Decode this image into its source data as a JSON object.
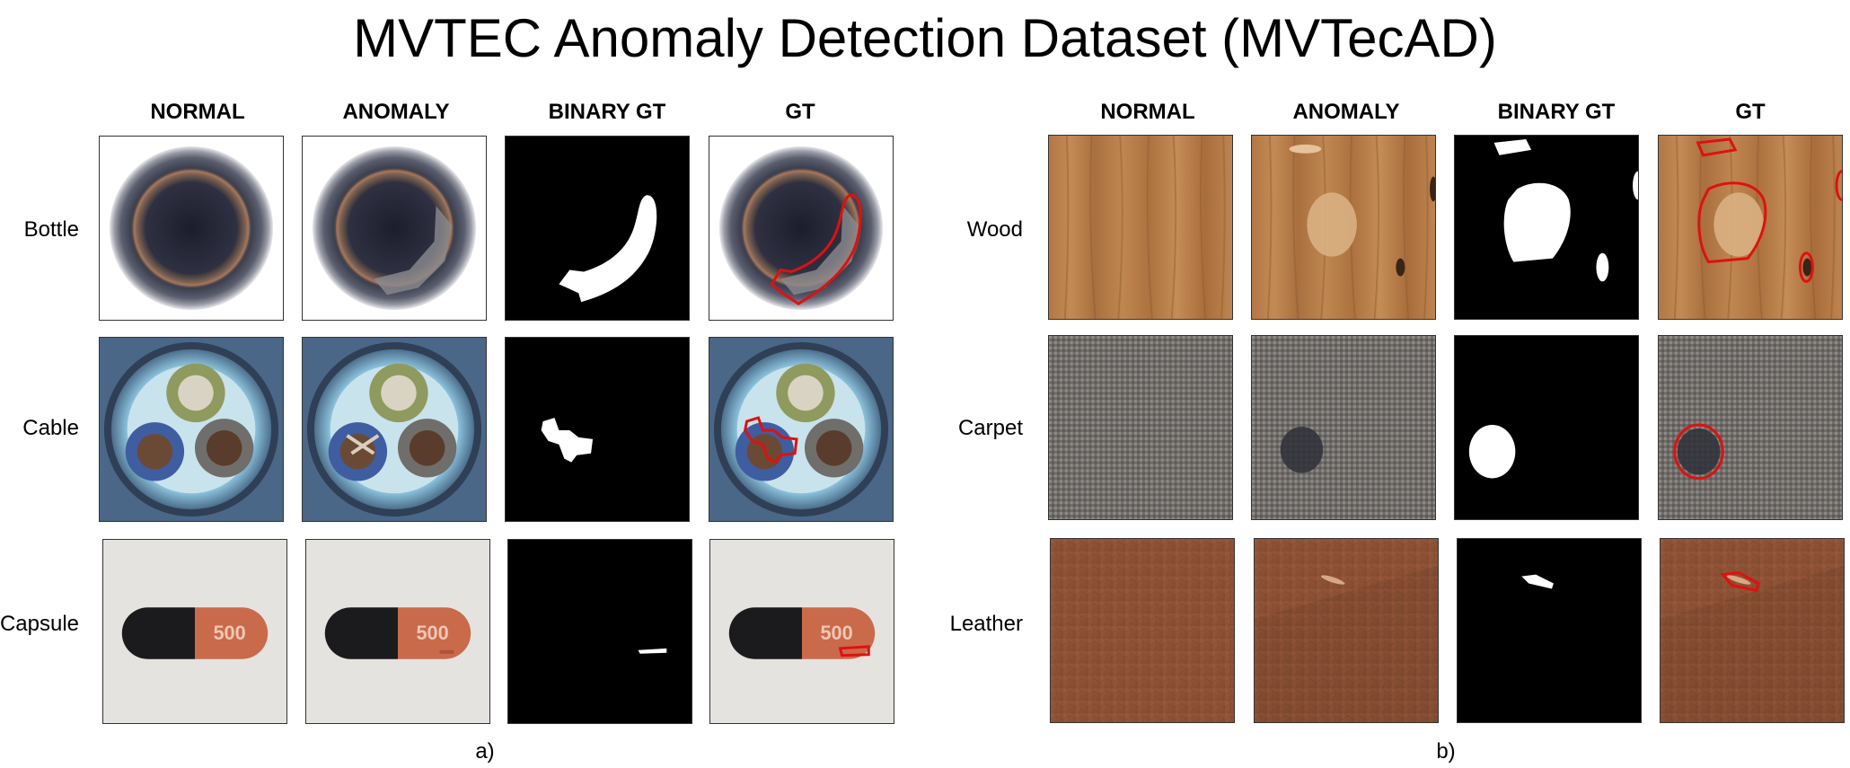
{
  "title": "MVTEC Anomaly Detection Dataset (MVTecAD)",
  "panel_a": {
    "columns": [
      "NORMAL",
      "ANOMALY",
      "BINARY GT",
      "GT"
    ],
    "rows": [
      "Bottle",
      "Cable",
      "Capsule"
    ],
    "caption": "a)"
  },
  "panel_b": {
    "columns": [
      "NORMAL",
      "ANOMALY",
      "BINARY GT",
      "GT"
    ],
    "rows": [
      "Wood",
      "Carpet",
      "Leather"
    ],
    "caption": "b)"
  },
  "capsule_print": "500",
  "colors": {
    "outline": "#e01010",
    "mask": "#ffffff",
    "mask_bg": "#000000"
  }
}
